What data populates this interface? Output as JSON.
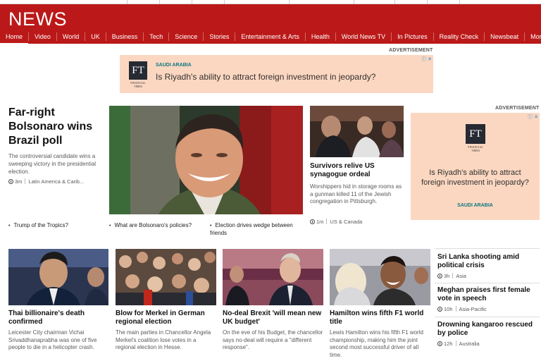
{
  "masthead": {
    "logo": "NEWS",
    "nav": [
      "Home",
      "Video",
      "World",
      "UK",
      "Business",
      "Tech",
      "Science",
      "Stories",
      "Entertainment & Arts",
      "Health",
      "World News TV",
      "In Pictures",
      "Reality Check",
      "Newsbeat",
      "More ▾"
    ],
    "brand_color": "#bb1919"
  },
  "ads": {
    "label": "ADVERTISEMENT",
    "banner": {
      "tag": "SAUDI ARABIA",
      "headline": "Is Riyadh's ability to attract foreign investment in jeopardy?",
      "logo_text": "FT",
      "logo_caption_1": "FINANCIAL",
      "logo_caption_2": "TIMES",
      "close": "ⓘ ✕"
    },
    "side": {
      "label": "ADVERTISEMENT",
      "headline_1": "Is Riyadh's ability to attract",
      "headline_2": "foreign investment in jeopardy?",
      "tag": "SAUDI ARABIA",
      "logo_text": "FT",
      "logo_caption_1": "FINANCIAL",
      "logo_caption_2": "TIMES",
      "close": "ⓘ ✕"
    },
    "background_color": "#fbd7c1"
  },
  "lead": {
    "title": "Far-right Bolsonaro wins Brazil poll",
    "summary": "The controversial candidate wins a sweeping victory in the presidential election.",
    "time": "3m",
    "section": "Latin America & Carib...",
    "related": [
      "Trump of the Tropics?",
      "What are Bolsonaro's policies?",
      "Election drives wedge between friends"
    ]
  },
  "second": {
    "title": "Survivors relive US synagogue ordeal",
    "summary": "Worshippers hid in storage rooms as a gunman killed 11 of the Jewish congregation in Pittsburgh.",
    "time": "1m",
    "section": "US & Canada"
  },
  "stories": [
    {
      "title": "Thai billionaire's death confirmed",
      "summary": "Leicester City chairman Vichai Srivaddhanaprabha was one of five people to die in a helicopter crash."
    },
    {
      "title": "Blow for Merkel in German regional election",
      "summary": "The main parties in Chancellor Angela Merkel's coalition lose votes in a regional election in Hesse."
    },
    {
      "title": "No-deal Brexit 'will mean new UK budget'",
      "summary": "On the eve of his Budget, the chancellor says no-deal will require a \"different response\"."
    },
    {
      "title": "Hamilton wins fifth F1 world title",
      "summary": "Lewis Hamilton wins his fifth F1 world championship, making him the joint second most successful driver of all time."
    }
  ],
  "list": [
    {
      "title": "Sri Lanka shooting amid political crisis",
      "time": "3h",
      "section": "Asia"
    },
    {
      "title": "Meghan praises first female vote in speech",
      "time": "10h",
      "section": "Asia-Pacific"
    },
    {
      "title": "Drowning kangaroo rescued by police",
      "time": "12h",
      "section": "Australia"
    }
  ]
}
